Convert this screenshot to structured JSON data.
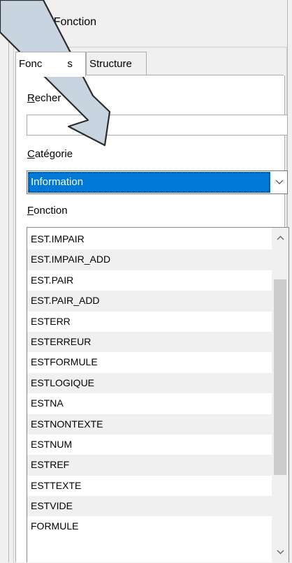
{
  "dialog": {
    "title": "ant Fonction"
  },
  "tabs": [
    {
      "label": "Fonc",
      "label_rest": "s",
      "active": true
    },
    {
      "label": "Structure",
      "active": false
    }
  ],
  "search": {
    "label_key": "R",
    "label_rest": "echer",
    "label_tail": "er",
    "value": "",
    "placeholder": ""
  },
  "category": {
    "label_key": "C",
    "label_rest": "atégorie",
    "selected": "Information"
  },
  "function": {
    "label_key": "F",
    "label_rest": "onction",
    "items": [
      "EST.IMPAIR",
      "EST.IMPAIR_ADD",
      "EST.PAIR",
      "EST.PAIR_ADD",
      "ESTERR",
      "ESTERREUR",
      "ESTFORMULE",
      "ESTLOGIQUE",
      "ESTNA",
      "ESTNONTEXTE",
      "ESTNUM",
      "ESTREF",
      "ESTTEXTE",
      "ESTVIDE",
      "FORMULE"
    ]
  },
  "icons": {
    "dropdown": "chevron-down-icon",
    "scroll_up": "chevron-up-icon",
    "scroll_down": "chevron-down-icon",
    "pointer": "arrow-pointer-icon"
  },
  "colors": {
    "selection": "#0078d7",
    "alt_row": "#f0f0f0",
    "pointer_fill": "#c8d4e0"
  }
}
